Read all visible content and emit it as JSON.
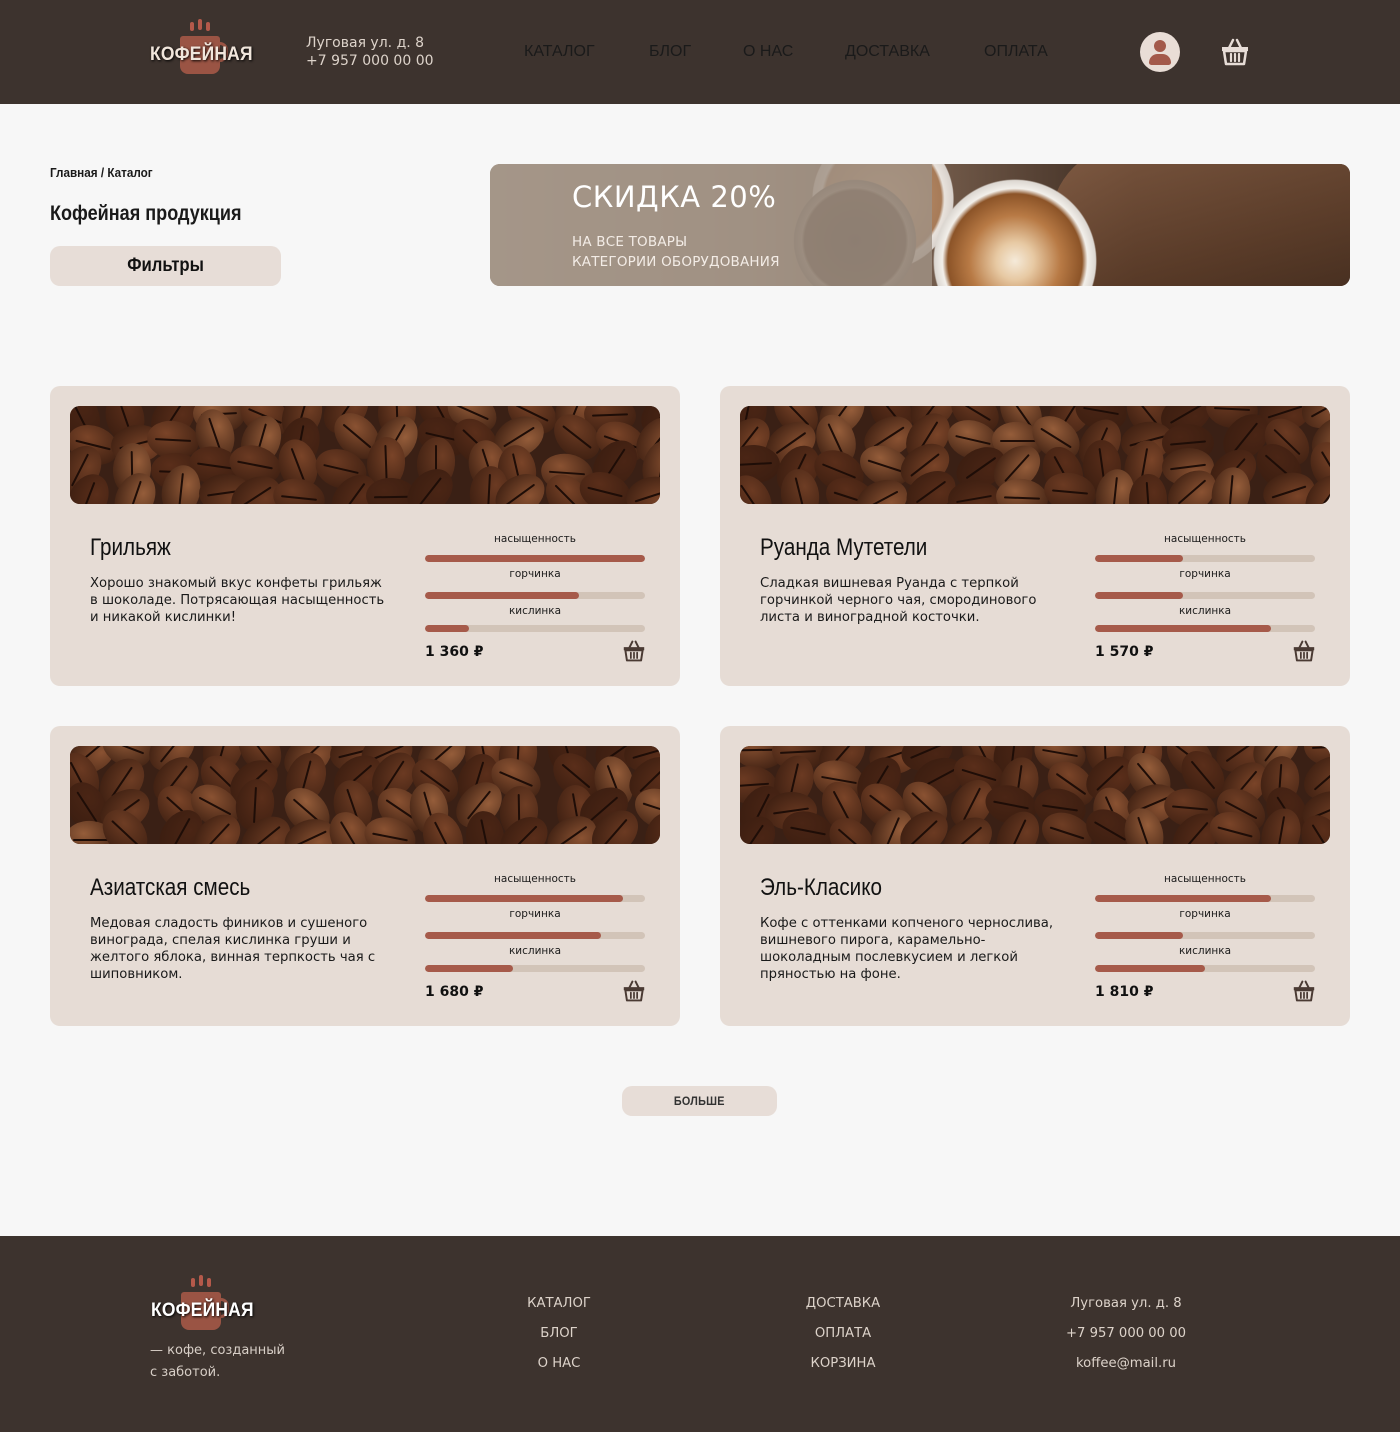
{
  "brand": {
    "logo_text": "КОФЕЙНАЯ",
    "tagline_line1": "— кофе, созданный",
    "tagline_line2": "с заботой."
  },
  "header": {
    "address": "Луговая ул. д. 8",
    "phone": "+7 957 000 00 00",
    "nav": [
      "КАТАЛОГ",
      "БЛОГ",
      "О НАС",
      "ДОСТАВКА",
      "ОПЛАТА"
    ],
    "profile_icon": "user-icon",
    "cart_icon": "basket-icon"
  },
  "breadcrumb": "Главная / Каталог",
  "page_title": "Кофейная продукция",
  "filters_label": "Фильтры",
  "banner": {
    "title": "СКИДКА 20%",
    "line1": "НА ВСЕ ТОВАРЫ",
    "line2": "КАТЕГОРИИ ОБОРУДОВАНИЯ"
  },
  "meter_labels": {
    "saturation": "насыщенность",
    "bitterness": "горчинка",
    "acidity": "кислинка"
  },
  "products": [
    {
      "name": "Грильяж",
      "description": "Хорошо знакомый вкус конфеты грильяж в шоколаде. Потрясающая насыщенность и никакой кислинки!",
      "saturation": 1.0,
      "bitterness": 0.7,
      "acidity": 0.2,
      "price": "1 360 ₽"
    },
    {
      "name": "Руанда Мутетели",
      "description": "Сладкая вишневая Руанда с терпкой горчинкой черного чая, смородинового листа и виноградной косточки.",
      "saturation": 0.4,
      "bitterness": 0.4,
      "acidity": 0.8,
      "price": "1 570 ₽"
    },
    {
      "name": "Азиатская смесь",
      "description": "Медовая сладость фиников и сушеного винограда, спелая кислинка груши и желтого яблока, винная терпкость чая с шиповником.",
      "saturation": 0.9,
      "bitterness": 0.8,
      "acidity": 0.4,
      "price": "1 680 ₽"
    },
    {
      "name": "Эль-Класико",
      "description": "Кофе с оттенками копченого чернослива, вишневого пирога, карамельно-шоколадным послевкусием и легкой пряностью на фоне.",
      "saturation": 0.8,
      "bitterness": 0.4,
      "acidity": 0.5,
      "price": "1 810 ₽"
    }
  ],
  "more_label": "БОЛЬШЕ",
  "footer": {
    "col1": [
      "КАТАЛОГ",
      "БЛОГ",
      "О НАС"
    ],
    "col2": [
      "ДОСТАВКА",
      "ОПЛАТА",
      "КОРЗИНА"
    ],
    "contacts": [
      "Луговая ул. д. 8",
      "+7 957 000 00 00",
      "koffee@mail.ru"
    ]
  },
  "colors": {
    "dark": "#3d332e",
    "card": "#e6dcd5",
    "accent": "#a65a4a",
    "track": "#d2c4b8",
    "button": "#e7ddd7"
  }
}
